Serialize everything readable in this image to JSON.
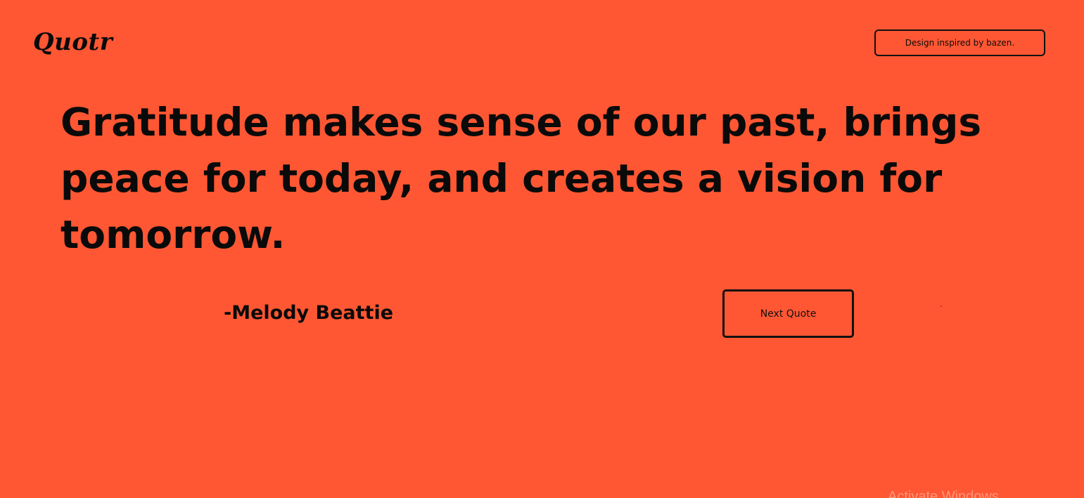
{
  "brand": {
    "logo_text": "Quotr"
  },
  "header": {
    "credit_label": "Design inspired by bazen."
  },
  "quote": {
    "text": "Gratitude makes sense of our past, brings peace for today, and creates a vision for tomorrow.",
    "author": "-Melody Beattie"
  },
  "actions": {
    "next_label": "Next Quote"
  },
  "overlay": {
    "watermark": "Activate Windows"
  },
  "colors": {
    "background": "#ff5733",
    "text": "#0a0a0a"
  }
}
